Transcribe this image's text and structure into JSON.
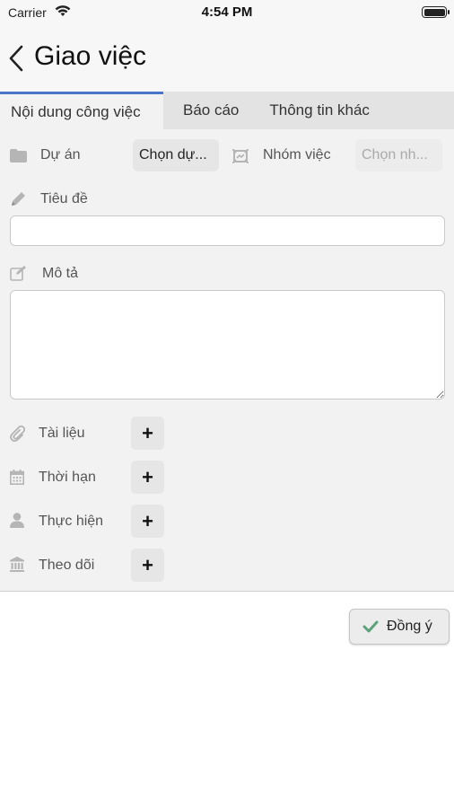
{
  "status_bar": {
    "carrier": "Carrier",
    "time": "4:54 PM"
  },
  "nav": {
    "title": "Giao việc"
  },
  "tabs": [
    {
      "label": "Nội dung công việc",
      "active": true
    },
    {
      "label": "Báo cáo",
      "active": false
    },
    {
      "label": "Thông tin khác",
      "active": false
    }
  ],
  "form": {
    "project": {
      "label": "Dự án",
      "button": "Chọn dự..."
    },
    "group": {
      "label": "Nhóm việc",
      "button": "Chọn nh..."
    },
    "title_field": {
      "label": "Tiêu đề",
      "value": ""
    },
    "description_field": {
      "label": "Mô tả",
      "value": ""
    },
    "attachments": {
      "label": "Tài liệu",
      "button": "+"
    },
    "deadline": {
      "label": "Thời hạn",
      "button": "+"
    },
    "assignee": {
      "label": "Thực hiện",
      "button": "+"
    },
    "followers": {
      "label": "Theo dõi",
      "button": "+"
    }
  },
  "actions": {
    "confirm": "Đồng ý"
  },
  "colors": {
    "tab_accent": "#4a74c9",
    "check_green": "#5ba27a",
    "icon_gray": "#b5b5b5"
  }
}
